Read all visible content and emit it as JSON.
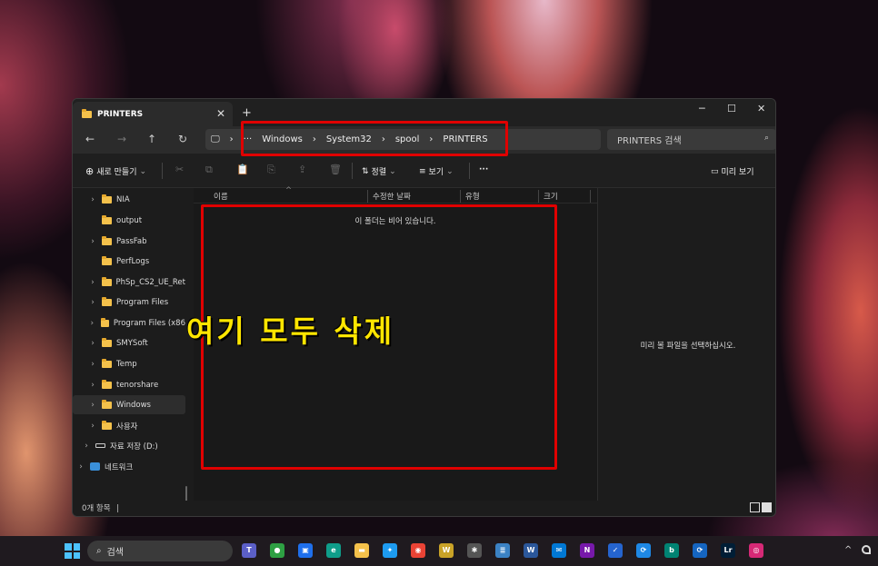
{
  "window": {
    "tab_title": "PRINTERS",
    "tab_close": "✕",
    "new_tab": "+",
    "min": "─",
    "max": "☐",
    "close": "✕"
  },
  "address": {
    "back": "←",
    "forward": "→",
    "up": "↑",
    "refresh": "↻",
    "pc_icon": "🖵",
    "ellipsis": "···",
    "crumbs": [
      "Windows",
      "System32",
      "spool",
      "PRINTERS"
    ],
    "separator": "›"
  },
  "search": {
    "placeholder": "PRINTERS 검색",
    "icon": "⌕"
  },
  "toolbar": {
    "new_label": "새로 만들기",
    "new_icon": "⊕",
    "sort_label": "정렬",
    "sort_icon": "⇅",
    "view_label": "보기",
    "view_icon": "≡",
    "more": "···",
    "preview_label": "미리 보기",
    "preview_icon": "▭",
    "dim_icons": [
      "✂",
      "⧉",
      "📋",
      "⎘",
      "⇪",
      "🗑"
    ]
  },
  "sidebar": {
    "items": [
      {
        "label": "NIA",
        "chev": "›"
      },
      {
        "label": "output",
        "chev": ""
      },
      {
        "label": "PassFab",
        "chev": "›"
      },
      {
        "label": "PerfLogs",
        "chev": ""
      },
      {
        "label": "PhSp_CS2_UE_Ret",
        "chev": "›"
      },
      {
        "label": "Program Files",
        "chev": "›"
      },
      {
        "label": "Program Files (x86",
        "chev": "›"
      },
      {
        "label": "SMYSoft",
        "chev": "›"
      },
      {
        "label": "Temp",
        "chev": "›"
      },
      {
        "label": "tenorshare",
        "chev": "›"
      },
      {
        "label": "Windows",
        "chev": "›"
      },
      {
        "label": "사용자",
        "chev": "›"
      },
      {
        "label": "자료 저장 (D:)",
        "chev": "›"
      },
      {
        "label": "네트워크",
        "chev": "›"
      }
    ]
  },
  "columns": {
    "name": "이름",
    "modified": "수정한 날짜",
    "type": "유형",
    "size": "크기",
    "sort_arrow": "^"
  },
  "empty_message": "이 폴더는 비어 있습니다.",
  "annotation": "여기 모두 삭제",
  "preview_message": "미리 볼 파일을 선택하십시오.",
  "status": {
    "count": "0개 항목",
    "cursor": "|"
  },
  "taskbar": {
    "search_label": "검색",
    "search_icon": "⌕",
    "tray_chevron": "^",
    "apps": [
      {
        "name": "teams",
        "glyph": "T",
        "color": "#5b5fc7"
      },
      {
        "name": "app-green",
        "glyph": "●",
        "color": "#2ea043"
      },
      {
        "name": "store",
        "glyph": "▣",
        "color": "#1f6feb"
      },
      {
        "name": "edge",
        "glyph": "e",
        "color": "#0f9d8a"
      },
      {
        "name": "explorer",
        "glyph": "▬",
        "color": "#f4c14b"
      },
      {
        "name": "app-bird",
        "glyph": "✦",
        "color": "#1d9bf0"
      },
      {
        "name": "chrome",
        "glyph": "◉",
        "color": "#ea4335"
      },
      {
        "name": "winamp",
        "glyph": "W",
        "color": "#c9a227"
      },
      {
        "name": "app-gear",
        "glyph": "✱",
        "color": "#555555"
      },
      {
        "name": "notepad",
        "glyph": "≣",
        "color": "#3b82c4"
      },
      {
        "name": "word",
        "glyph": "W",
        "color": "#2b579a"
      },
      {
        "name": "chat",
        "glyph": "✉",
        "color": "#0078d4"
      },
      {
        "name": "onenote",
        "glyph": "N",
        "color": "#7719aa"
      },
      {
        "name": "todo",
        "glyph": "✓",
        "color": "#2564cf"
      },
      {
        "name": "sync",
        "glyph": "⟳",
        "color": "#1e88e5"
      },
      {
        "name": "bing",
        "glyph": "b",
        "color": "#008373"
      },
      {
        "name": "sync2",
        "glyph": "⟳",
        "color": "#1565c0"
      },
      {
        "name": "lightroom",
        "glyph": "Lr",
        "color": "#001e36"
      },
      {
        "name": "instagram",
        "glyph": "◎",
        "color": "#d62976"
      }
    ]
  }
}
